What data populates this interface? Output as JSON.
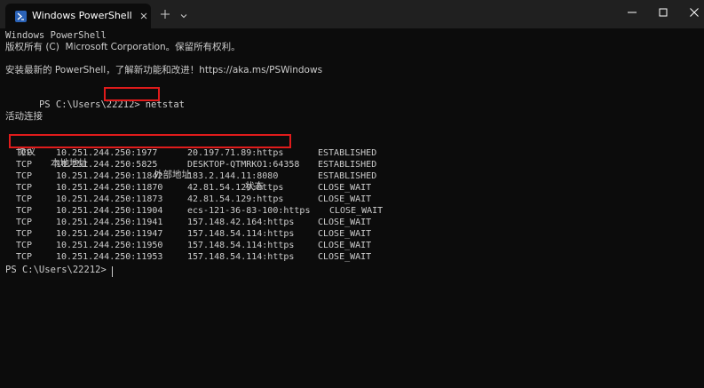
{
  "titlebar": {
    "tab_title": "Windows PowerShell"
  },
  "icons": {
    "tab": "powershell-icon",
    "close": "close-icon",
    "new_tab": "plus-icon",
    "dropdown": "chevron-down-icon",
    "minimize": "minimize-icon",
    "maximize": "maximize-icon",
    "window_close": "close-icon"
  },
  "colors": {
    "background": "#0c0c0c",
    "titlebar": "#202020",
    "text": "#cccccc",
    "highlight": "#e01b1b"
  },
  "terminal": {
    "banner_1": "Windows PowerShell",
    "banner_2": "版权所有 (C)  Microsoft Corporation。保留所有权利。",
    "banner_3": "安装最新的 PowerShell，了解新功能和改进！https://aka.ms/PSWindows",
    "prompt": "PS C:\\Users\\22212>",
    "command": "netstat",
    "section_title": "活动连接",
    "headers": [
      "协议",
      "本地地址",
      "外部地址",
      "状态"
    ],
    "rows": [
      [
        "TCP",
        "10.251.244.250:1977",
        "20.197.71.89:https",
        "ESTABLISHED"
      ],
      [
        "TCP",
        "10.251.244.250:5825",
        "DESKTOP-QTMRKO1:64358",
        "ESTABLISHED"
      ],
      [
        "TCP",
        "10.251.244.250:11842",
        "183.2.144.11:8080",
        "ESTABLISHED"
      ],
      [
        "TCP",
        "10.251.244.250:11870",
        "42.81.54.129:https",
        "CLOSE_WAIT"
      ],
      [
        "TCP",
        "10.251.244.250:11873",
        "42.81.54.129:https",
        "CLOSE_WAIT"
      ],
      [
        "TCP",
        "10.251.244.250:11904",
        "ecs-121-36-83-100:https",
        "CLOSE_WAIT"
      ],
      [
        "TCP",
        "10.251.244.250:11941",
        "157.148.42.164:https",
        "CLOSE_WAIT"
      ],
      [
        "TCP",
        "10.251.244.250:11947",
        "157.148.54.114:https",
        "CLOSE_WAIT"
      ],
      [
        "TCP",
        "10.251.244.250:11950",
        "157.148.54.114:https",
        "CLOSE_WAIT"
      ],
      [
        "TCP",
        "10.251.244.250:11953",
        "157.148.54.114:https",
        "CLOSE_WAIT"
      ]
    ],
    "final_prompt": "PS C:\\Users\\22212>"
  }
}
